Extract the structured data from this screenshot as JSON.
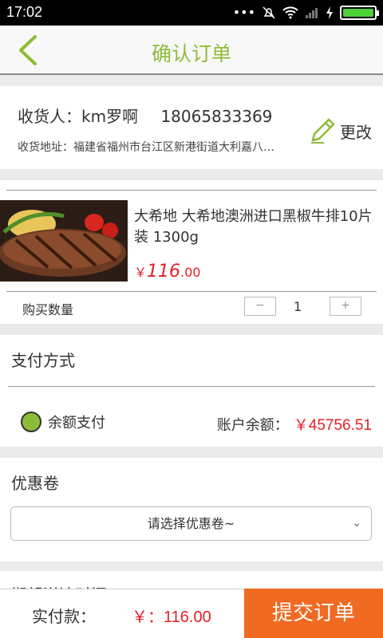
{
  "status_bar": {
    "time": "17:02",
    "icons": [
      "more-dots-icon",
      "mute-icon",
      "wifi-icon",
      "signal-icon",
      "charging-icon",
      "battery-icon"
    ],
    "battery_level": 1.0
  },
  "header": {
    "title": "确认订单",
    "back_icon": "chevron-left-icon"
  },
  "address": {
    "receiver_label": "收货人：km罗啊",
    "phone": "18065833369",
    "address_line": "收货地址：福建省福州市台江区新港街道大利嘉八…",
    "edit_label": "更改",
    "edit_icon": "pencil-icon"
  },
  "product": {
    "name": "大希地 大希地澳洲进口黑椒牛排10片装 1300g",
    "price_symbol": "￥",
    "price_int": "116",
    "price_dec": ".00",
    "qty_label": "购买数量",
    "qty_minus": "−",
    "qty_value": "1",
    "qty_plus": "+"
  },
  "payment": {
    "title": "支付方式",
    "option_label": "余额支付",
    "balance_label": "账户余额：",
    "balance_amount": "￥45756.51"
  },
  "coupon": {
    "title": "优惠卷",
    "select_placeholder": "请选择优惠卷~"
  },
  "next_section": {
    "title": "期望送达时间"
  },
  "bottom": {
    "pay_label": "实付款：",
    "pay_total": "￥：116.00",
    "submit_label": "提交订单"
  },
  "colors": {
    "accent_green": "#8dbd38",
    "price_red": "#e31f26",
    "submit_orange": "#f06a22"
  }
}
